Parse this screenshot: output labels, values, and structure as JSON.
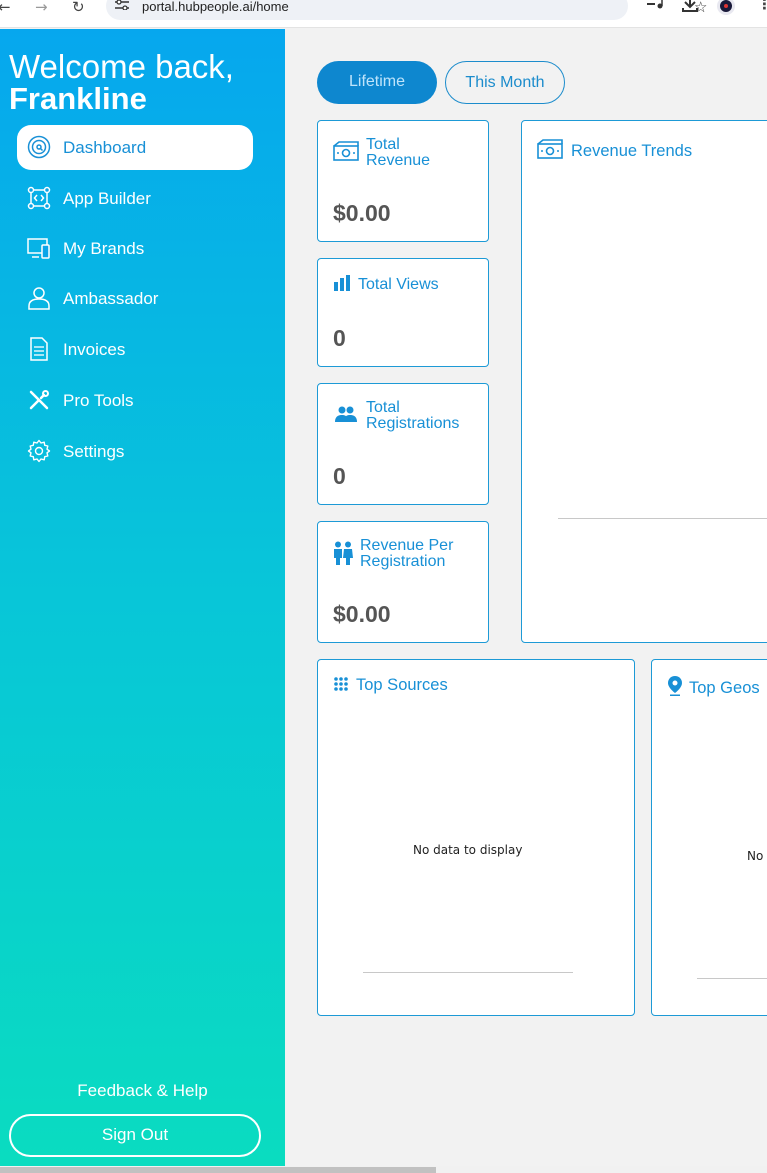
{
  "browser": {
    "url": "portal.hubpeople.ai/home",
    "icons": [
      "back-icon",
      "forward-icon",
      "reload-icon",
      "site-settings-icon",
      "star-icon",
      "media-icon",
      "download-icon",
      "profile-icon",
      "menu-icon"
    ]
  },
  "sidebar": {
    "welcome": "Welcome back,",
    "name": "Frankline",
    "items": [
      {
        "label": "Dashboard",
        "icon": "dashboard-icon",
        "active": true
      },
      {
        "label": "App Builder",
        "icon": "app-builder-icon"
      },
      {
        "label": "My Brands",
        "icon": "brands-icon"
      },
      {
        "label": "Ambassador",
        "icon": "user-icon"
      },
      {
        "label": "Invoices",
        "icon": "document-icon"
      },
      {
        "label": "Pro Tools",
        "icon": "tools-icon"
      },
      {
        "label": "Settings",
        "icon": "gear-icon"
      }
    ],
    "feedback": "Feedback & Help",
    "signout": "Sign Out",
    "colors": {
      "top": "#06a7ee",
      "bottom": "#0adcc0"
    }
  },
  "filters": {
    "lifetime": "Lifetime",
    "this_month": "This Month",
    "active": "Lifetime"
  },
  "stats": {
    "total_revenue": {
      "title_line1": "Total",
      "title_line2": "Revenue",
      "value": "$0.00",
      "icon": "money-icon"
    },
    "total_views": {
      "title": "Total Views",
      "value": "0",
      "icon": "bar-chart-icon"
    },
    "total_registrations": {
      "title_line1": "Total",
      "title_line2": "Registrations",
      "value": "0",
      "icon": "users-icon"
    },
    "revenue_per_registration": {
      "title_line1": "Revenue Per",
      "title_line2": "Registration",
      "value": "$0.00",
      "icon": "people-icon"
    }
  },
  "panels": {
    "revenue_trends": {
      "title": "Revenue Trends",
      "icon": "money-icon"
    },
    "top_sources": {
      "title": "Top Sources",
      "empty": "No data to display",
      "icon": "grid-icon"
    },
    "top_geos": {
      "title": "Top Geos",
      "empty": "No",
      "icon": "location-pin-icon"
    }
  },
  "accent": "#1890d6"
}
